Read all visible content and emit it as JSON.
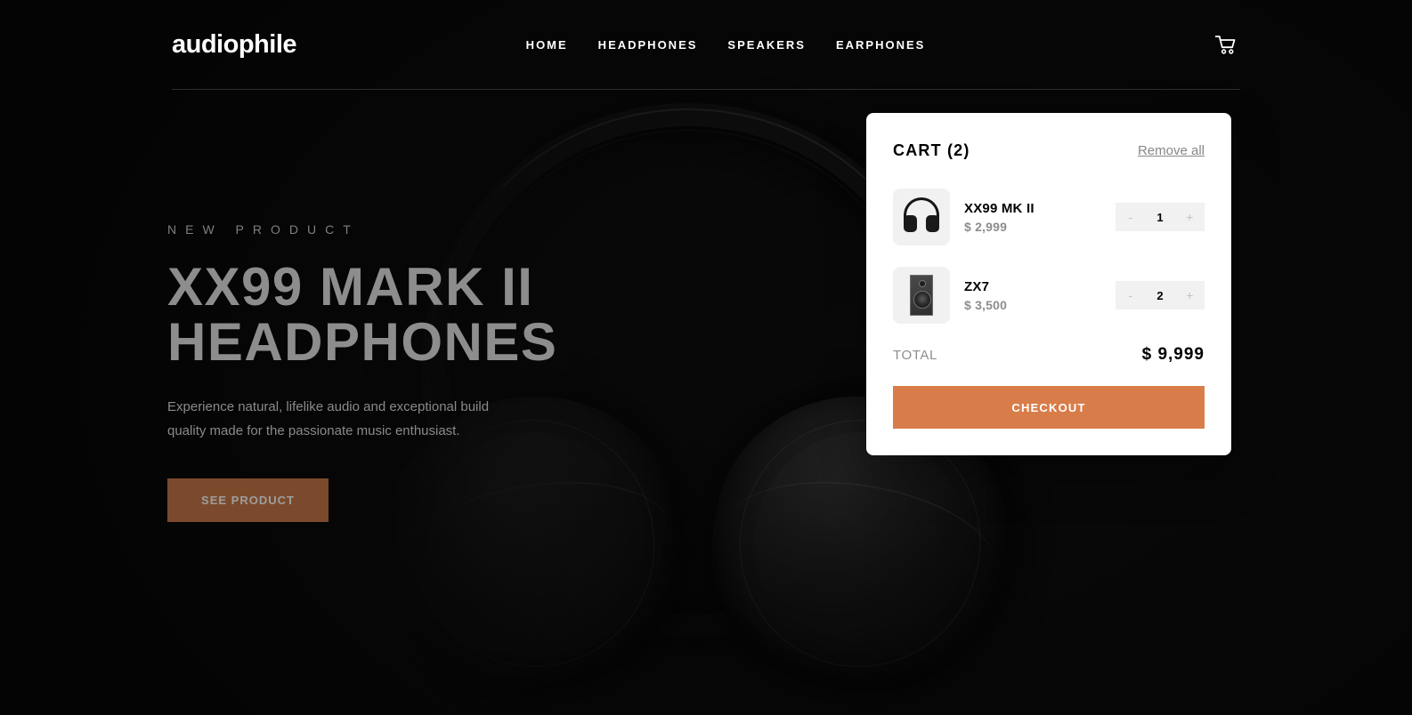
{
  "header": {
    "logo": "audiophile",
    "nav": [
      {
        "label": "HOME"
      },
      {
        "label": "HEADPHONES"
      },
      {
        "label": "SPEAKERS"
      },
      {
        "label": "EARPHONES"
      }
    ],
    "cart_icon": "shopping-cart-icon"
  },
  "hero": {
    "overline": "NEW PRODUCT",
    "title": "XX99 MARK II\nHEADPHONES",
    "description": "Experience natural, lifelike audio and exceptional build quality made for the passionate music enthusiast.",
    "cta_label": "SEE PRODUCT"
  },
  "cart": {
    "title": "CART (2)",
    "remove_all_label": "Remove all",
    "items": [
      {
        "name": "XX99 MK II",
        "price": "$ 2,999",
        "quantity": "1",
        "decrement_label": "-",
        "increment_label": "+",
        "thumb_icon": "headphones-thumbnail"
      },
      {
        "name": "ZX7",
        "price": "$ 3,500",
        "quantity": "2",
        "decrement_label": "-",
        "increment_label": "+",
        "thumb_icon": "speaker-thumbnail"
      }
    ],
    "total_label": "TOTAL",
    "total_value": "$ 9,999",
    "checkout_label": "CHECKOUT"
  },
  "colors": {
    "accent": "#D87D4A",
    "background": "#101010",
    "panel": "#FFFFFF",
    "muted_text": "#8D8D8D",
    "stepper_bg": "#F1F1F1"
  }
}
